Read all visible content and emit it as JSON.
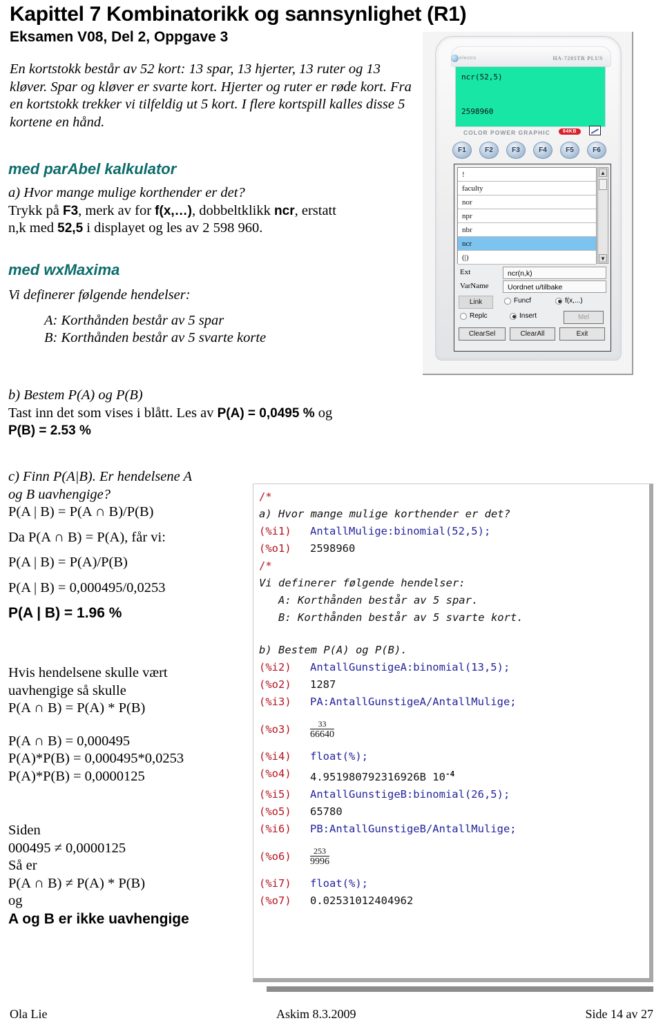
{
  "document": {
    "title": "Kapittel 7 Kombinatorikk og sannsynlighet (R1)",
    "subtitle": "Eksamen V08, Del 2, Oppgave 3",
    "intro": "En kortstokk består av 52 kort: 13 spar, 13 hjerter, 13 ruter og 13 kløver. Spar og kløver er svarte kort. Hjerter og ruter er røde kort. Fra en kortstokk trekker vi tilfeldig ut 5 kort. I flere kortspill kalles disse 5 kortene en hånd."
  },
  "headings": {
    "parabel": "med parAbel kalkulator",
    "wxmaxima": "med wxMaxima",
    "color": "#0d6b6b"
  },
  "section_a": {
    "question": "a) Hvor mange mulige korthender er det?",
    "line1_part1": "Trykk på ",
    "line1_b1": "F3",
    "line1_part2": ", merk av for ",
    "line1_b2": "f(x,…)",
    "line1_part3": ", dobbeltklikk ",
    "line1_b3": "ncr",
    "line1_part4": ", erstatt",
    "line2_part1": "n,k med ",
    "line2_b1": "52,5",
    "line2_part2": " i displayet og les av 2 598 960."
  },
  "section_wx": {
    "lead": "Vi definerer følgende hendelser:",
    "eventA": "A: Korthånden består av 5 spar",
    "eventB": "B: Korthånden består av 5 svarte korte"
  },
  "section_b": {
    "question": "b) Bestem P(A) og P(B)",
    "line1_part1": "Tast inn det som vises i blått. Les av ",
    "line1_b1": "P(A) = 0,0495 %",
    "line1_part2": " og",
    "line2_b1": "P(B) = 2.53 %"
  },
  "section_c": {
    "q1": "c) Finn P(A|B). Er hendelsene A",
    "q2": "og B uavhengige?",
    "l1": "P(A | B) = P(A ∩ B)/P(B)",
    "l2": "Da P(A ∩ B) = P(A), får vi:",
    "l3": "P(A | B) = P(A)/P(B)",
    "l4": "P(A | B) = 0,000495/0,0253",
    "l5_bold": "P(A | B) = 1.96 %"
  },
  "section_d": {
    "l1": "Hvis hendelsene skulle vært",
    "l2": "uavhengige så skulle",
    "l3": "P(A ∩ B) = P(A) * P(B)",
    "l4": "P(A ∩ B) = 0,000495",
    "l5": "P(A)*P(B) = 0,000495*0,0253",
    "l6": "P(A)*P(B) = 0,0000125"
  },
  "section_e": {
    "l1": "Siden",
    "l2": "000495 ≠ 0,0000125",
    "l3": "Så er",
    "l4": "P(A ∩ B) ≠ P(A) * P(B)",
    "l5": "og",
    "l6_bold": "A og B er ikke uavhengige"
  },
  "calculator": {
    "brand": "electro",
    "model": "HA-7205TR PLUS",
    "screen_expr": "ncr(52,5)",
    "screen_result": "2598960",
    "screen_color": "#18e6a4",
    "label": "COLOR POWER GRAPHIC",
    "memory_badge": "64KB",
    "fkeys": [
      "F1",
      "F2",
      "F3",
      "F4",
      "F5",
      "F6"
    ],
    "dialog": {
      "list_items": [
        "!",
        "faculty",
        "nor",
        "npr",
        "nbr",
        "ncr",
        "(|)"
      ],
      "selected_item": "ncr",
      "selection_color": "#7cc3f0",
      "label_ext": "Ext",
      "value_ext": "ncr(n,k)",
      "label_varname": "VarName",
      "value_varname": "Uordnet u/tilbake",
      "btn_link": "Link",
      "btn_mel": "Mel",
      "btn_clearsel": "ClearSel",
      "btn_clearall": "ClearAll",
      "btn_exit": "Exit",
      "radio_funcf": "Funcf",
      "radio_fx": "f(x,...)",
      "radio_replc": "Replc",
      "radio_insert": "Insert",
      "scroll_up": "▲",
      "scroll_down": "▼"
    }
  },
  "code_panel": {
    "comment_open_1": "/*",
    "comment_a": "a) Hvor mange mulige korthender er det?",
    "i1_label": "(%i1)",
    "i1_code": "AntallMulige:binomial(52,5);",
    "o1_label": "(%o1)",
    "o1_value": "2598960",
    "comment_open_2": "/*",
    "comment_def": "Vi definerer følgende hendelser:",
    "comment_eventA": "   A: Korthånden består av 5 spar.",
    "comment_eventB": "   B: Korthånden består av 5 svarte kort.",
    "comment_b": "b) Bestem P(A) og P(B).",
    "i2_label": "(%i2)",
    "i2_code": "AntallGunstigeA:binomial(13,5);",
    "o2_label": "(%o2)",
    "o2_value": "1287",
    "i3_label": "(%i3)",
    "i3_code": "PA:AntallGunstigeA/AntallMulige;",
    "o3_label": "(%o3)",
    "o3_num": "33",
    "o3_den": "66640",
    "i4_label": "(%i4)",
    "i4_code": "float(%);",
    "o4_label": "(%o4)",
    "o4_mantissa": "4.951980792316926B 10",
    "o4_exp": "-4",
    "i5_label": "(%i5)",
    "i5_code": "AntallGunstigeB:binomial(26,5);",
    "o5_label": "(%o5)",
    "o5_value": "65780",
    "i6_label": "(%i6)",
    "i6_code": "PB:AntallGunstigeB/AntallMulige;",
    "o6_label": "(%o6)",
    "o6_num": "253",
    "o6_den": "9996",
    "i7_label": "(%i7)",
    "i7_code": "float(%);",
    "o7_label": "(%o7)",
    "o7_value": "0.02531012404962",
    "colors": {
      "prompt": "#b3141e",
      "input": "#23239c",
      "output": "#111111"
    }
  },
  "footer": {
    "author": "Ola Lie",
    "place": "Askim 8.3.2009",
    "page": "Side 14 av 27"
  }
}
